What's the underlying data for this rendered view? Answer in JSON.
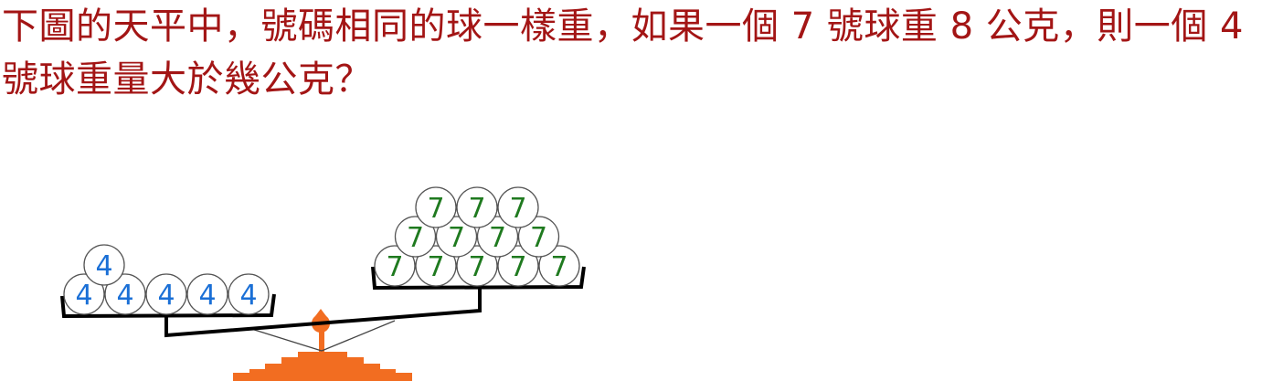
{
  "question": {
    "text": "下圖的天平中，號碼相同的球一樣重，如果一個 7 號球重 8 公克，則一個 4 號球重量大於幾公克？"
  },
  "scale": {
    "left_pan": {
      "ball_label": "4",
      "rows": [
        5,
        1
      ],
      "color": "#1a6fd6"
    },
    "right_pan": {
      "ball_label": "7",
      "rows": [
        5,
        4,
        3
      ],
      "color": "#1f7a1f"
    },
    "colors": {
      "text": "#a31515",
      "beam": "#000000",
      "base": "#f26d21",
      "ball_outline": "#555555"
    }
  }
}
